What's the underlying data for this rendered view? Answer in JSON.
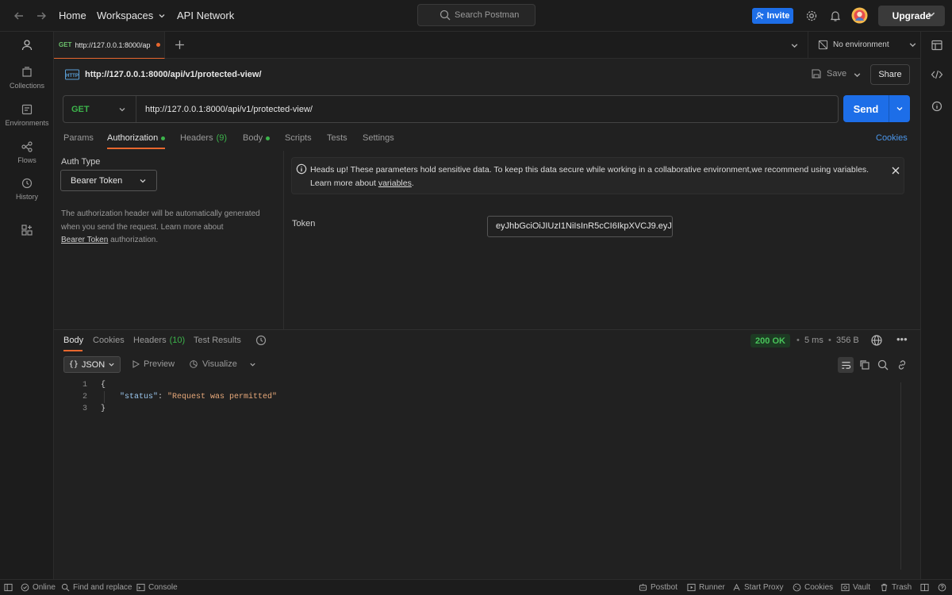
{
  "topbar": {
    "home": "Home",
    "workspaces": "Workspaces",
    "api_network": "API Network",
    "search_placeholder": "Search Postman",
    "invite": "Invite",
    "upgrade": "Upgrade"
  },
  "rail": {
    "items": [
      {
        "label": "Collections"
      },
      {
        "label": "Environments"
      },
      {
        "label": "Flows"
      },
      {
        "label": "History"
      }
    ]
  },
  "tab": {
    "method": "GET",
    "title": "http://127.0.0.1:8000/ap",
    "environment": "No environment"
  },
  "request": {
    "name": "http://127.0.0.1:8000/api/v1/protected-view/",
    "save": "Save",
    "share": "Share",
    "method": "GET",
    "url": "http://127.0.0.1:8000/api/v1/protected-view/",
    "send": "Send"
  },
  "subtabs": {
    "params": "Params",
    "authorization": "Authorization",
    "headers": "Headers",
    "headers_count": "(9)",
    "body": "Body",
    "scripts": "Scripts",
    "tests": "Tests",
    "settings": "Settings",
    "cookies": "Cookies"
  },
  "auth": {
    "type_label": "Auth Type",
    "type_value": "Bearer Token",
    "desc_1": "The authorization header will be automatically generated",
    "desc_2": "when you send the request. Learn more about",
    "desc_link": "Bearer Token",
    "desc_3": " authorization.",
    "banner_1": "Heads up! These parameters hold sensitive data. To keep this data secure while working in a collaborative environment,we recommend using variables.",
    "banner_2": "Learn more about ",
    "banner_link": "variables",
    "banner_3": ".",
    "token_label": "Token",
    "token_value": "eyJhbGciOiJIUzI1NiIsInR5cCI6IkpXVCJ9.eyJ..."
  },
  "response": {
    "tabs": {
      "body": "Body",
      "cookies": "Cookies",
      "headers": "Headers",
      "headers_count": "(10)",
      "test_results": "Test Results"
    },
    "status": "200 OK",
    "time": "5 ms",
    "size": "356 B",
    "format": "JSON",
    "preview": "Preview",
    "visualize": "Visualize",
    "lines": {
      "n1": "1",
      "n2": "2",
      "n3": "3",
      "open": "{",
      "key": "\"status\"",
      "colon": ": ",
      "value": "\"Request was permitted\"",
      "close": "}"
    }
  },
  "statusbar": {
    "online": "Online",
    "find_replace": "Find and replace",
    "console": "Console",
    "postbot": "Postbot",
    "runner": "Runner",
    "start_proxy": "Start Proxy",
    "cookies": "Cookies",
    "vault": "Vault",
    "trash": "Trash"
  },
  "colors": {
    "accent": "#1d6ee8",
    "tab_indicator": "#e8672e",
    "success": "#49c45a"
  }
}
